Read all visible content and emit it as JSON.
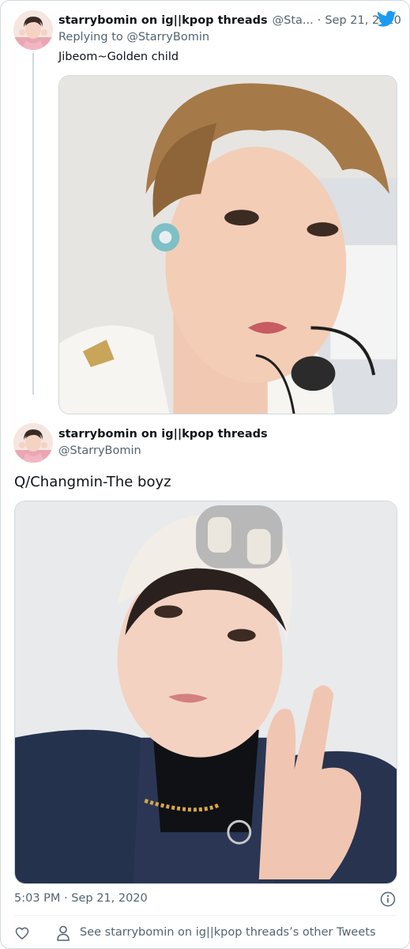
{
  "parent_tweet": {
    "display_name": "starrybomin on ig||kpop threads",
    "handle": "@Sta...",
    "separator": "·",
    "date": "Sep 21, 2020",
    "replying_to": "Replying to @StarryBomin",
    "text": "Jibeom~Golden child",
    "avatar_icon": "profile-photo",
    "media_icon": "selfie-photo"
  },
  "main_tweet": {
    "display_name": "starrybomin on ig||kpop threads",
    "handle": "@StarryBomin",
    "text": "Q/Changmin-The boyz",
    "timestamp": "5:03 PM · Sep 21, 2020",
    "avatar_icon": "profile-photo",
    "media_icon": "selfie-photo"
  },
  "footer": {
    "other_tweets": "See starrybomin on ig||kpop threads’s other Tweets",
    "like_icon": "heart-icon",
    "profile_icon": "person-icon",
    "info_icon": "info-icon"
  },
  "brand": {
    "logo_icon": "twitter-bird-icon",
    "accent": "#1d9bf0",
    "text_primary": "#0f1419",
    "text_secondary": "#536471"
  }
}
